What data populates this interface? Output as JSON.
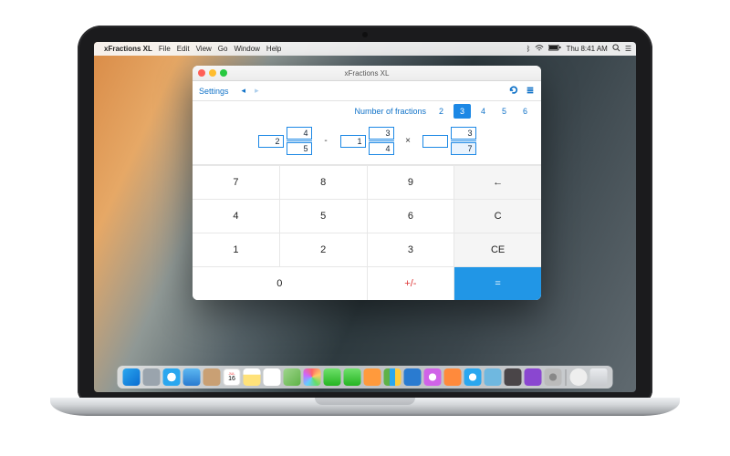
{
  "os": {
    "menu": {
      "app": "xFractions XL",
      "items": [
        "File",
        "Edit",
        "View",
        "Go",
        "Window",
        "Help"
      ]
    },
    "status": {
      "clock": "Thu 8:41 AM"
    }
  },
  "window": {
    "title": "xFractions XL",
    "toolbar": {
      "settings": "Settings"
    },
    "count": {
      "label": "Number of fractions",
      "options": [
        "2",
        "3",
        "4",
        "5",
        "6"
      ],
      "active": "3"
    },
    "expr": {
      "f1": {
        "whole": "2",
        "num": "4",
        "den": "5"
      },
      "op1": "-",
      "f2": {
        "whole": "1",
        "num": "3",
        "den": "4"
      },
      "op2": "×",
      "f3": {
        "whole": "",
        "num": "3",
        "den": "7"
      }
    },
    "keypad": {
      "k7": "7",
      "k8": "8",
      "k9": "9",
      "back": "←",
      "k4": "4",
      "k5": "5",
      "k6": "6",
      "c": "C",
      "k1": "1",
      "k2": "2",
      "k3": "3",
      "ce": "CE",
      "k0": "0",
      "pm": "+/-",
      "eq": "="
    }
  }
}
